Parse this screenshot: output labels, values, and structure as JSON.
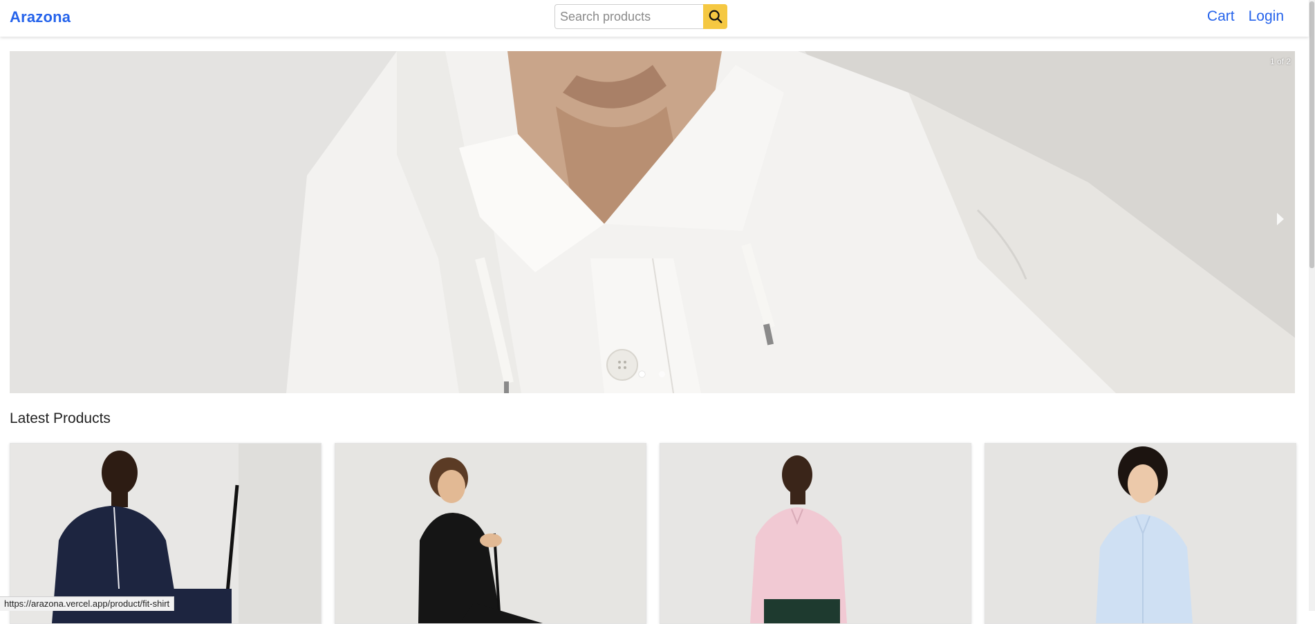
{
  "header": {
    "brand": "Arazona",
    "search_placeholder": "Search products",
    "search_icon": "search-icon",
    "nav": {
      "cart": "Cart",
      "login": "Login"
    },
    "brand_color": "#2563eb",
    "search_button_color": "#f5c842"
  },
  "hero": {
    "counter": "1 of 2",
    "slides_total": 2,
    "active_slide": 1,
    "next_icon": "chevron-right-icon"
  },
  "latest": {
    "title": "Latest Products",
    "products": [
      {
        "image": "man-navy-polo-golf-photo"
      },
      {
        "image": "man-black-polo-golf-photo"
      },
      {
        "image": "man-pink-shirt-photo"
      },
      {
        "image": "man-light-blue-shirt-photo"
      }
    ]
  },
  "status_bar": {
    "url": "https://arazona.vercel.app/product/fit-shirt"
  }
}
